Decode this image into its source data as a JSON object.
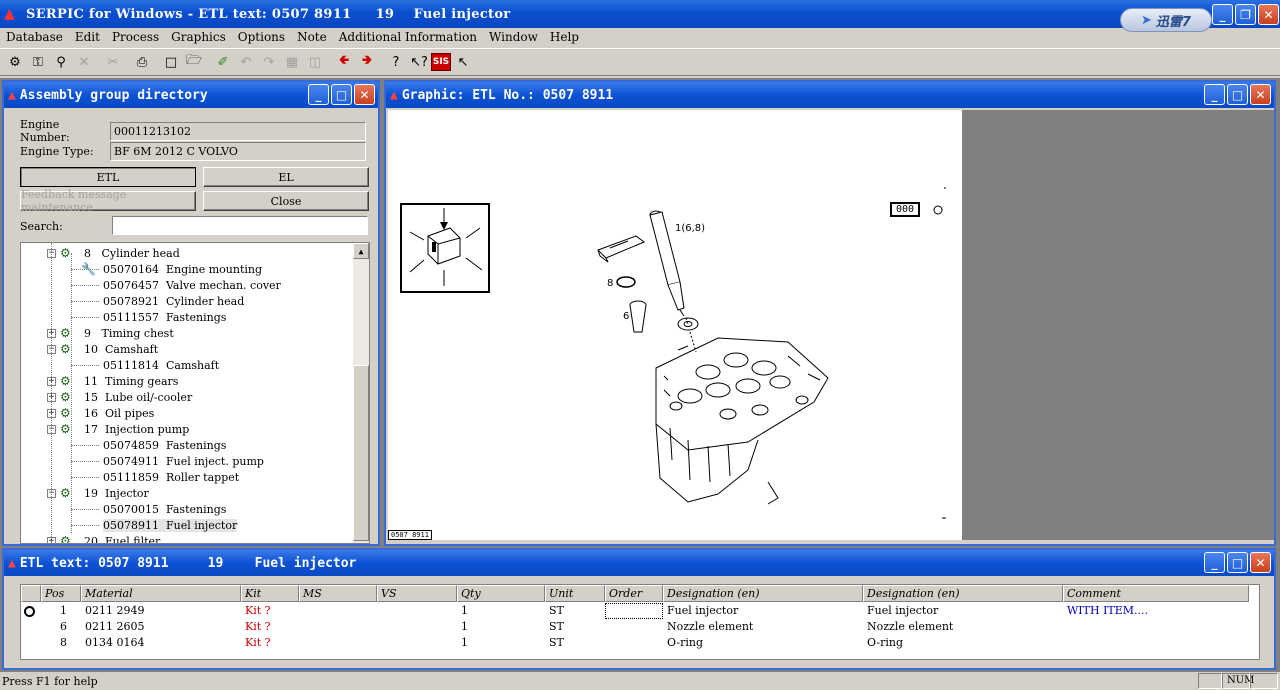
{
  "app": {
    "title": "SERPIC for Windows - ETL text: 0507 8911     19    Fuel injector",
    "xunlei_label": "迅雷7"
  },
  "menu": [
    "Database",
    "Edit",
    "Process",
    "Graphics",
    "Options",
    "Note",
    "Additional Information",
    "Window",
    "Help"
  ],
  "toolbar": {
    "sis_label": "SIS"
  },
  "assembly": {
    "title": "Assembly group directory",
    "engine_number_label": "Engine Number:",
    "engine_number": "00011213102",
    "engine_type_label": "Engine Type:",
    "engine_type": "BF 6M 2012 C VOLVO",
    "btn_etl": "ETL",
    "btn_el": "EL",
    "btn_feedback": "Feedback message maintenance",
    "btn_close": "Close",
    "search_label": "Search:",
    "search_value": "",
    "tree": [
      {
        "level": 0,
        "exp": "−",
        "text": "8   Cylinder head"
      },
      {
        "level": 1,
        "text": "05070164  Engine mounting",
        "tool": true
      },
      {
        "level": 1,
        "text": "05076457  Valve mechan. cover"
      },
      {
        "level": 1,
        "text": "05078921  Cylinder head"
      },
      {
        "level": 1,
        "text": "05111557  Fastenings"
      },
      {
        "level": 0,
        "exp": "+",
        "text": "9   Timing chest"
      },
      {
        "level": 0,
        "exp": "−",
        "text": "10  Camshaft"
      },
      {
        "level": 1,
        "text": "05111814  Camshaft"
      },
      {
        "level": 0,
        "exp": "+",
        "text": "11  Timing gears"
      },
      {
        "level": 0,
        "exp": "+",
        "text": "15  Lube oil/-cooler"
      },
      {
        "level": 0,
        "exp": "+",
        "text": "16  Oil pipes"
      },
      {
        "level": 0,
        "exp": "−",
        "text": "17  Injection pump"
      },
      {
        "level": 1,
        "text": "05074859  Fastenings"
      },
      {
        "level": 1,
        "text": "05074911  Fuel inject. pump"
      },
      {
        "level": 1,
        "text": "05111859  Roller tappet"
      },
      {
        "level": 0,
        "exp": "−",
        "text": "19  Injector"
      },
      {
        "level": 1,
        "text": "05070015  Fastenings"
      },
      {
        "level": 1,
        "text": "05078911  Fuel injector",
        "selected": true
      },
      {
        "level": 0,
        "exp": "+",
        "text": "20  Fuel filter"
      }
    ]
  },
  "graphic": {
    "title": "Graphic: ETL No.: 0507 8911",
    "label_1": "1(6,8)",
    "label_8": "8",
    "label_6": "6",
    "box_label": "000",
    "ref_label": "0507 8911"
  },
  "etl": {
    "title": "ETL text: 0507 8911     19    Fuel injector",
    "columns": [
      "",
      "Pos",
      "Material",
      "Kit",
      "MS",
      "VS",
      "Qty",
      "Unit",
      "Order",
      "Designation (en)",
      "Designation (en)",
      "Comment"
    ],
    "rows": [
      {
        "pos": "1",
        "material": "0211 2949",
        "kit": "Kit ?",
        "ms": "",
        "vs": "",
        "qty": "1",
        "unit": "ST",
        "order": "",
        "des1": "Fuel injector",
        "des2": "Fuel injector",
        "comment": "WITH ITEM...."
      },
      {
        "pos": "6",
        "material": "0211 2605",
        "kit": "Kit ?",
        "ms": "",
        "vs": "",
        "qty": "1",
        "unit": "ST",
        "order": "",
        "des1": "Nozzle element",
        "des2": "Nozzle element",
        "comment": ""
      },
      {
        "pos": "8",
        "material": "0134 0164",
        "kit": "Kit ?",
        "ms": "",
        "vs": "",
        "qty": "1",
        "unit": "ST",
        "order": "",
        "des1": "O-ring",
        "des2": "O-ring",
        "comment": ""
      }
    ]
  },
  "status": {
    "help": "Press F1 for help",
    "num": "NUM"
  }
}
